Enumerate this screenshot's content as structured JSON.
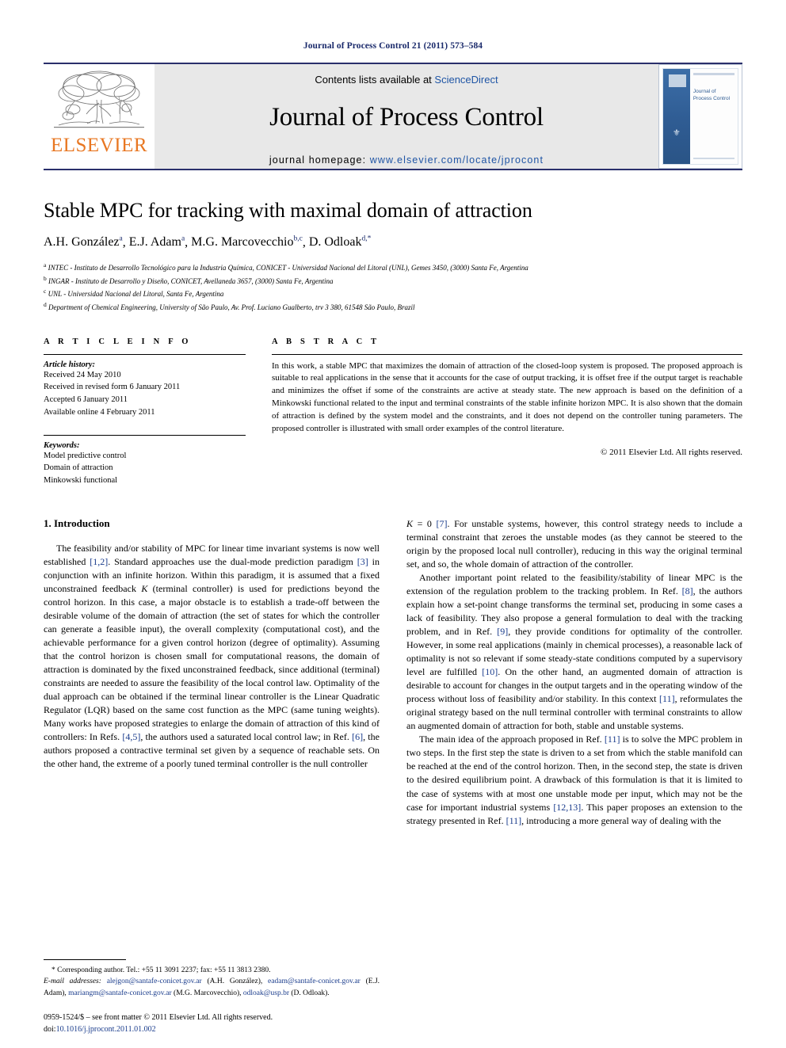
{
  "running_head": "Journal of Process Control 21 (2011) 573–584",
  "masthead": {
    "contents_prefix": "Contents lists available at ",
    "sciencedirect": "ScienceDirect",
    "journal_title": "Journal of Process Control",
    "homepage_label": "journal homepage:",
    "homepage_url": "www.elsevier.com/locate/jprocont",
    "publisher_logo_text": "ELSEVIER",
    "cover_title_line1": "Journal of",
    "cover_title_line2": "Process Control",
    "accent_color": "#1f55a5",
    "logo_color": "#e87722",
    "rule_color": "#2a2f6b"
  },
  "article": {
    "title": "Stable MPC for tracking with maximal domain of attraction",
    "authors": [
      {
        "name": "A.H. González",
        "sup": "a"
      },
      {
        "name": "E.J. Adam",
        "sup": "a"
      },
      {
        "name": "M.G. Marcovecchio",
        "sup": "b,c"
      },
      {
        "name": "D. Odloak",
        "sup": "d,*"
      }
    ],
    "affiliations": [
      {
        "marker": "a",
        "text": "INTEC - Instituto de Desarrollo Tecnológico para la Industria Química, CONICET - Universidad Nacional del Litoral (UNL), Gemes 3450, (3000) Santa Fe, Argentina"
      },
      {
        "marker": "b",
        "text": "INGAR - Instituto de Desarrollo y Diseño, CONICET, Avellaneda 3657, (3000) Santa Fe, Argentina"
      },
      {
        "marker": "c",
        "text": "UNL - Universidad Nacional del Litoral, Santa Fe, Argentina"
      },
      {
        "marker": "d",
        "text": "Department of Chemical Engineering, University of São Paulo, Av. Prof. Luciano Gualberto, trv 3 380, 61548 São Paulo, Brazil"
      }
    ]
  },
  "article_info": {
    "heading": "A R T I C L E    I N F O",
    "history_label": "Article history:",
    "history": [
      "Received 24 May 2010",
      "Received in revised form 6 January 2011",
      "Accepted 6 January 2011",
      "Available online 4 February 2011"
    ],
    "keywords_label": "Keywords:",
    "keywords": [
      "Model predictive control",
      "Domain of attraction",
      "Minkowski functional"
    ]
  },
  "abstract": {
    "heading": "A B S T R A C T",
    "text": "In this work, a stable MPC that maximizes the domain of attraction of the closed-loop system is proposed. The proposed approach is suitable to real applications in the sense that it accounts for the case of output tracking, it is offset free if the output target is reachable and minimizes the offset if some of the constraints are active at steady state. The new approach is based on the definition of a Minkowski functional related to the input and terminal constraints of the stable infinite horizon MPC. It is also shown that the domain of attraction is defined by the system model and the constraints, and it does not depend on the controller tuning parameters. The proposed controller is illustrated with small order examples of the control literature.",
    "copyright": "© 2011 Elsevier Ltd. All rights reserved."
  },
  "body": {
    "section_number_title": "1.  Introduction",
    "left_paragraph_1_a": "The feasibility and/or stability of MPC for linear time invariant systems is now well established ",
    "ref_1_2": "[1,2]",
    "left_paragraph_1_b": ". Standard approaches use the dual-mode prediction paradigm ",
    "ref_3": "[3]",
    "left_paragraph_1_c": " in conjunction with an infinite horizon. Within this paradigm, it is assumed that a fixed unconstrained feedback ",
    "var_K": "K",
    "left_paragraph_1_d": " (terminal controller) is used for predictions beyond the control horizon. In this case, a major obstacle is to establish a trade-off between the desirable volume of the domain of attraction (the set of states for which the controller can generate a feasible input), the overall complexity (computational cost), and the achievable performance for a given control horizon (degree of optimality). Assuming that the control horizon is chosen small for computational reasons, the domain of attraction is dominated by the fixed unconstrained feedback, since additional (terminal) constraints are needed to assure the feasibility of the local control law. Optimality of the dual approach can be obtained if the terminal linear controller is the Linear Quadratic Regulator (LQR) based on the same cost function as the MPC (same tuning weights). Many works have proposed strategies to enlarge the domain of attraction of this kind of controllers: In Refs. ",
    "ref_4_5": "[4,5]",
    "left_paragraph_1_e": ", the authors used a saturated local control law; in Ref. ",
    "ref_6": "[6]",
    "left_paragraph_1_f": ", the authors proposed a contractive terminal set given by a sequence of reachable sets. On the other hand, the extreme of a poorly tuned terminal controller is the null controller ",
    "right_paragraph_1_a": " = 0 ",
    "ref_7": "[7]",
    "right_paragraph_1_b": ". For unstable systems, however, this control strategy needs to include a terminal constraint that zeroes the unstable modes (as they cannot be steered to the origin by the proposed local null controller), reducing in this way the original terminal set, and so, the whole domain of attraction of the controller.",
    "right_paragraph_2_a": "Another important point related to the feasibility/stability of linear MPC is the extension of the regulation problem to the tracking problem. In Ref. ",
    "ref_8": "[8]",
    "right_paragraph_2_b": ", the authors explain how a set-point change transforms the terminal set, producing in some cases a lack of feasibility. They also propose a general formulation to deal with the tracking problem, and in Ref. ",
    "ref_9": "[9]",
    "right_paragraph_2_c": ", they provide conditions for optimality of the controller. However, in some real applications (mainly in chemical processes), a reasonable lack of optimality is not so relevant if some steady-state conditions computed by a supervisory level are fulfilled ",
    "ref_10": "[10]",
    "right_paragraph_2_d": ". On the other hand, an augmented domain of attraction is desirable to account for changes in the output targets and in the operating window of the process without loss of feasibility and/or stability. In this context ",
    "ref_11": "[11]",
    "right_paragraph_2_e": ", reformulates the original strategy based on the null terminal controller with terminal constraints to allow an augmented domain of attraction for both, stable and unstable systems.",
    "right_paragraph_3_a": "The main idea of the approach proposed in Ref. ",
    "ref_11b": "[11]",
    "right_paragraph_3_b": " is to solve the MPC problem in two steps. In the first step the state is driven to a set from which the stable manifold can be reached at the end of the control horizon. Then, in the second step, the state is driven to the desired equilibrium point. A drawback of this formulation is that it is limited to the case of systems with at most one unstable mode per input, which may not be the case for important industrial systems ",
    "ref_12_13": "[12,13]",
    "right_paragraph_3_c": ". This paper proposes an extension to the strategy presented in Ref. ",
    "ref_11c": "[11]",
    "right_paragraph_3_d": ", introducing a more general way of dealing with the"
  },
  "footnote": {
    "corresponding": "* Corresponding author. Tel.: +55 11 3091 2237; fax: +55 11 3813 2380.",
    "email_label": "E-mail addresses:",
    "emails": [
      {
        "address": "alejgon@santafe-conicet.gov.ar",
        "owner": "(A.H. González),"
      },
      {
        "address": "eadam@santafe-conicet.gov.ar",
        "owner": "(E.J. Adam),"
      },
      {
        "address": "mariangm@santafe-conicet.gov.ar",
        "owner": "(M.G. Marcovecchio),"
      },
      {
        "address": "odloak@usp.br",
        "owner": "(D. Odloak)."
      }
    ]
  },
  "imprint": {
    "line1": "0959-1524/$ – see front matter © 2011 Elsevier Ltd. All rights reserved.",
    "doi_label": "doi:",
    "doi": "10.1016/j.jprocont.2011.01.002"
  }
}
